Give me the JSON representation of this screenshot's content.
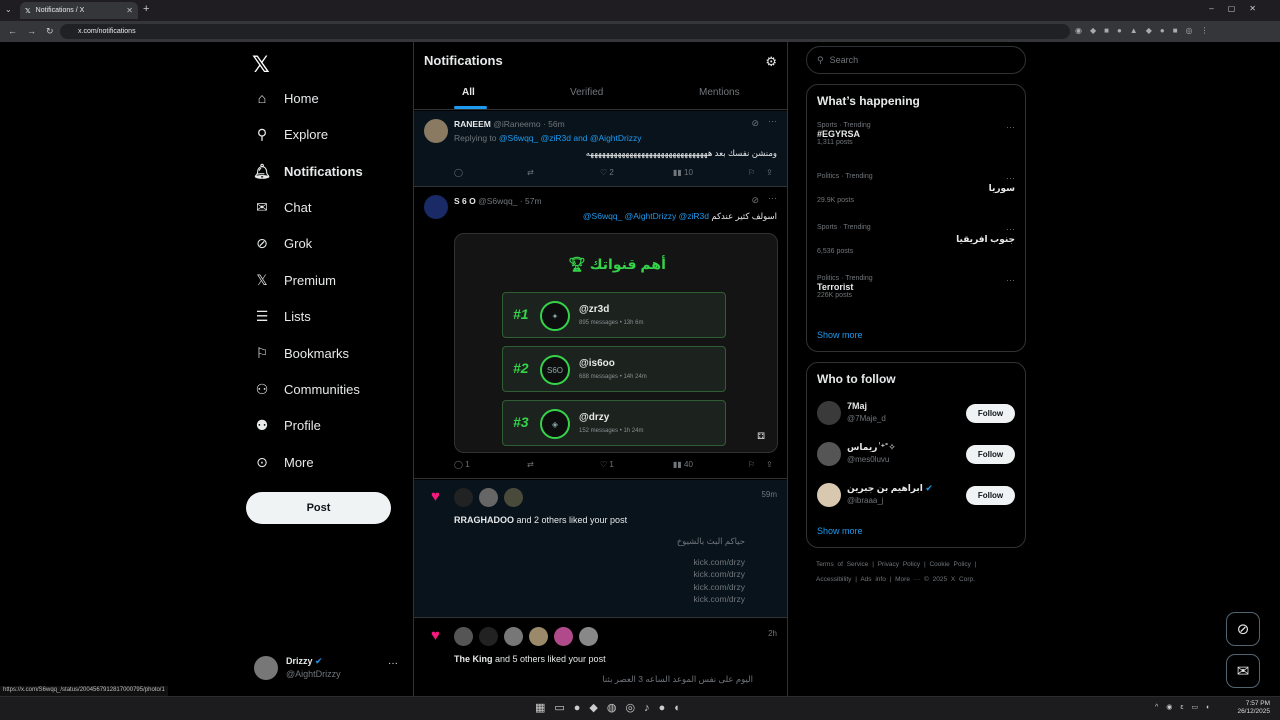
{
  "browser": {
    "tab_title": "Notifications / X",
    "url": "x.com/notifications",
    "status_url": "https://x.com/S6wqq_/status/2004567912817000795/photo/1"
  },
  "nav": {
    "items": [
      "Home",
      "Explore",
      "Notifications",
      "Chat",
      "Grok",
      "Premium",
      "Lists",
      "Bookmarks",
      "Communities",
      "Profile",
      "More"
    ],
    "post": "Post",
    "me_name": "Drizzy",
    "me_handle": "@AightDrizzy"
  },
  "main": {
    "title": "Notifications",
    "tabs": [
      "All",
      "Verified",
      "Mentions"
    ],
    "t1": {
      "name": "RANEEM",
      "handle": "@iRaneemo",
      "time": "· 56m",
      "reply_prefix": "Replying to",
      "reply_users": "@S6wqq_ @ziR3d and @AightDrizzy",
      "text": "ومنشن نفسك بعد هههههههههههههههههههههههههههههههه",
      "replies": "",
      "retweets": "",
      "likes": "2",
      "views": "10"
    },
    "t2": {
      "name": "S 6 O",
      "handle": "@S6wqq_",
      "time": "· 57m",
      "mentions": "@S6wqq_ @AightDrizzy @ziR3d",
      "text": "اسولف كثير عندكم",
      "card_title": "أهم قنواتك",
      "ranks": [
        {
          "num": "#1",
          "name": "@zr3d",
          "sub": "895 messages • 13h 6m"
        },
        {
          "num": "#2",
          "name": "@is6oo",
          "sub": "688 messages • 14h 24m"
        },
        {
          "num": "#3",
          "name": "@drzy",
          "sub": "152 messages • 1h 24m"
        }
      ],
      "replies": "1",
      "likes": "1",
      "views": "40"
    },
    "n1": {
      "time": "59m",
      "who": "RRAGHADOO",
      "rest": " and 2 others liked your post",
      "lines": [
        "حياكم البث بالشيوخ",
        "",
        "kick.com/drzy",
        "kick.com/drzy",
        "kick.com/drzy",
        "kick.com/drzy"
      ]
    },
    "n2": {
      "time": "2h",
      "who": "The King",
      "rest": " and 5 others liked your post",
      "line": "اليوم على نفس الموعد الساعه 3 العصر بثنا"
    }
  },
  "side": {
    "search": "Search",
    "happening": "What’s happening",
    "trends": [
      {
        "meta": "Sports · Trending",
        "name": "#EGYRSA",
        "count": "1,311 posts"
      },
      {
        "meta": "Politics · Trending",
        "name": "سوريا",
        "count": "29.9K posts"
      },
      {
        "meta": "Sports · Trending",
        "name": "جنوب افريقيا",
        "count": "6,536 posts"
      },
      {
        "meta": "Politics · Trending",
        "name": "Terrorist",
        "count": "226K posts"
      }
    ],
    "show_more": "Show more",
    "wtf": "Who to follow",
    "follows": [
      {
        "name": "7Maj",
        "handle": "@7Maje_d"
      },
      {
        "name": "ريماس ٰ⁺˚✧",
        "handle": "@mes0luvu"
      },
      {
        "name": "ابراهيم بن جبرين",
        "handle": "@ibraaa_j"
      }
    ],
    "follow_label": "Follow",
    "show_more2": "Show more",
    "footer1": "Terms of Service  |  Privacy Policy  |  Cookie Policy  |",
    "footer2": "Accessibility  |  Ads info  |  More ···  © 2025 X Corp."
  },
  "taskbar": {
    "time": "7:57 PM",
    "date": "26/12/2025"
  }
}
